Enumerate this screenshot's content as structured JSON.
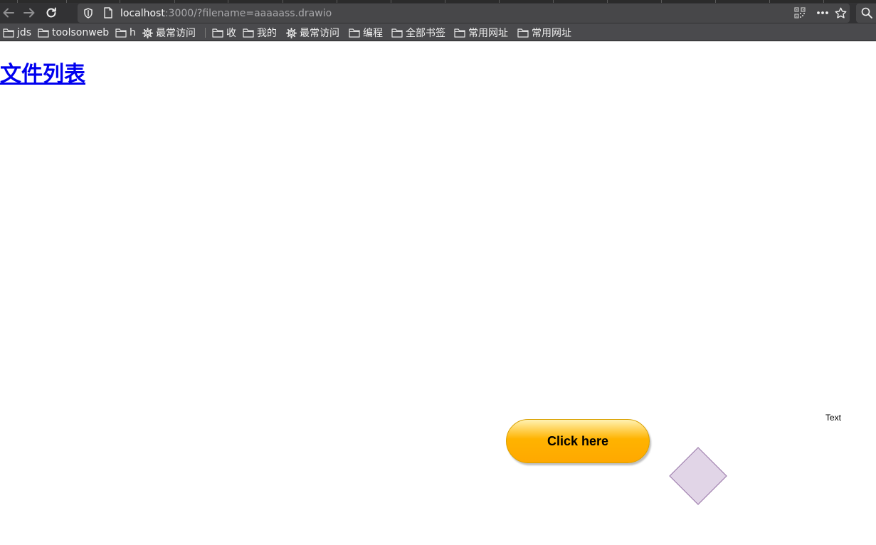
{
  "browser": {
    "url_host": "localhost",
    "url_rest": ":3000/?filename=aaaaass.drawio",
    "icons": {
      "back": "back-arrow-icon",
      "forward": "forward-arrow-icon",
      "reload": "reload-icon",
      "shield": "tracking-shield-icon",
      "page": "page-info-icon",
      "qr": "qr-code-icon",
      "more": "more-dots-icon",
      "star": "bookmark-star-icon",
      "search": "search-icon"
    }
  },
  "bookmarks": [
    {
      "label": "jds",
      "icon": "folder-icon"
    },
    {
      "label": "toolsonweb",
      "icon": "folder-icon"
    },
    {
      "label": "h",
      "icon": "folder-icon"
    },
    {
      "label": "最常访问",
      "icon": "gear-icon"
    },
    {
      "label": "收",
      "icon": "folder-icon"
    },
    {
      "label": "我的",
      "icon": "folder-icon"
    },
    {
      "label": "最常访问",
      "icon": "gear-icon"
    },
    {
      "label": "编程",
      "icon": "folder-icon"
    },
    {
      "label": "全部书签",
      "icon": "folder-icon"
    },
    {
      "label": "常用网址",
      "icon": "folder-icon"
    },
    {
      "label": "常用网址",
      "icon": "folder-icon"
    }
  ],
  "page": {
    "title_link": "文件列表",
    "diagram_text": "Text",
    "button_label": "Click here",
    "colors": {
      "link": "#0000ee",
      "button_top": "#ffe680",
      "button_bottom": "#ffa800",
      "diamond_fill": "#e1d5e7",
      "diamond_stroke": "#9673a6"
    }
  }
}
